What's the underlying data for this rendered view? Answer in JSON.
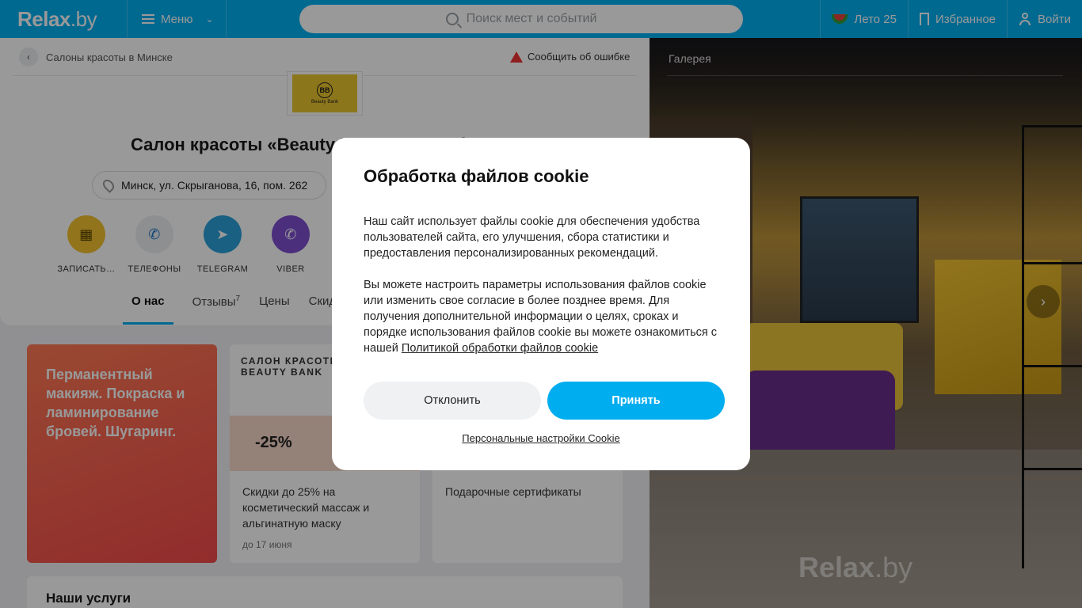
{
  "header": {
    "logo_main": "Relax",
    "logo_suffix": ".by",
    "menu_label": "Меню",
    "search_placeholder": "Поиск мест и событий",
    "summer_label": "Лето 25",
    "favorites_label": "Избранное",
    "login_label": "Войти"
  },
  "breadcrumb": {
    "back_label": "Салоны красоты в Минске"
  },
  "report_label": "Сообщить об ошибке",
  "business": {
    "logo_text": "Beauty Bank",
    "logo_mark": "BB",
    "title": "Салон красоты «Beauty Bank (Бьюти бэнк)»",
    "address": "Минск, ул. Скрыганова, 16, пом. 262"
  },
  "actions": [
    {
      "label": "ЗАПИСАТЬ…",
      "icon": "calendar-icon",
      "color": "#f2c230"
    },
    {
      "label": "ТЕЛЕФОНЫ",
      "icon": "phone-icon",
      "color": "#eceef0"
    },
    {
      "label": "TELEGRAM",
      "icon": "telegram-icon",
      "color": "#2aa1da"
    },
    {
      "label": "VIBER",
      "icon": "viber-icon",
      "color": "#7d4fd0"
    }
  ],
  "tabs": [
    {
      "label": "О нас",
      "active": true
    },
    {
      "label": "Отзывы",
      "count": "7"
    },
    {
      "label": "Цены"
    },
    {
      "label": "Скидки"
    }
  ],
  "promo": {
    "text": "Перманентный макияж. Покраска и ламинирование бровей. Шугаринг."
  },
  "cards": [
    {
      "brand_line1": "САЛОН КРАСОТЫ",
      "brand_line2": "BEAUTY BANK",
      "badge": "-25%",
      "text": "Скидки до 25% на косметический массаж и альгинатную маску",
      "sub": "до 17 июня"
    },
    {
      "text": "Подарочные сертификаты"
    }
  ],
  "services_title": "Наши услуги",
  "gallery": {
    "title": "Галерея",
    "watermark_main": "Relax",
    "watermark_suffix": ".by"
  },
  "cookie_modal": {
    "title": "Обработка файлов cookie",
    "para1": "Наш сайт использует файлы cookie для обеспечения удобства пользователей сайта, его улучшения, сбора статистики и предоставления персонализированных рекомендаций.",
    "para2": "Вы можете настроить параметры использования файлов cookie или изменить свое согласие в более позднее время. Для получения дополнительной информации о целях, сроках и порядке использования файлов cookie вы можете ознакомиться с нашей",
    "policy_link": "Политикой обработки файлов cookie",
    "decline_label": "Отклонить",
    "accept_label": "Принять",
    "settings_label": "Персональные настройки Cookie"
  },
  "colors": {
    "brand": "#00b0f0",
    "accept": "#00adef"
  }
}
